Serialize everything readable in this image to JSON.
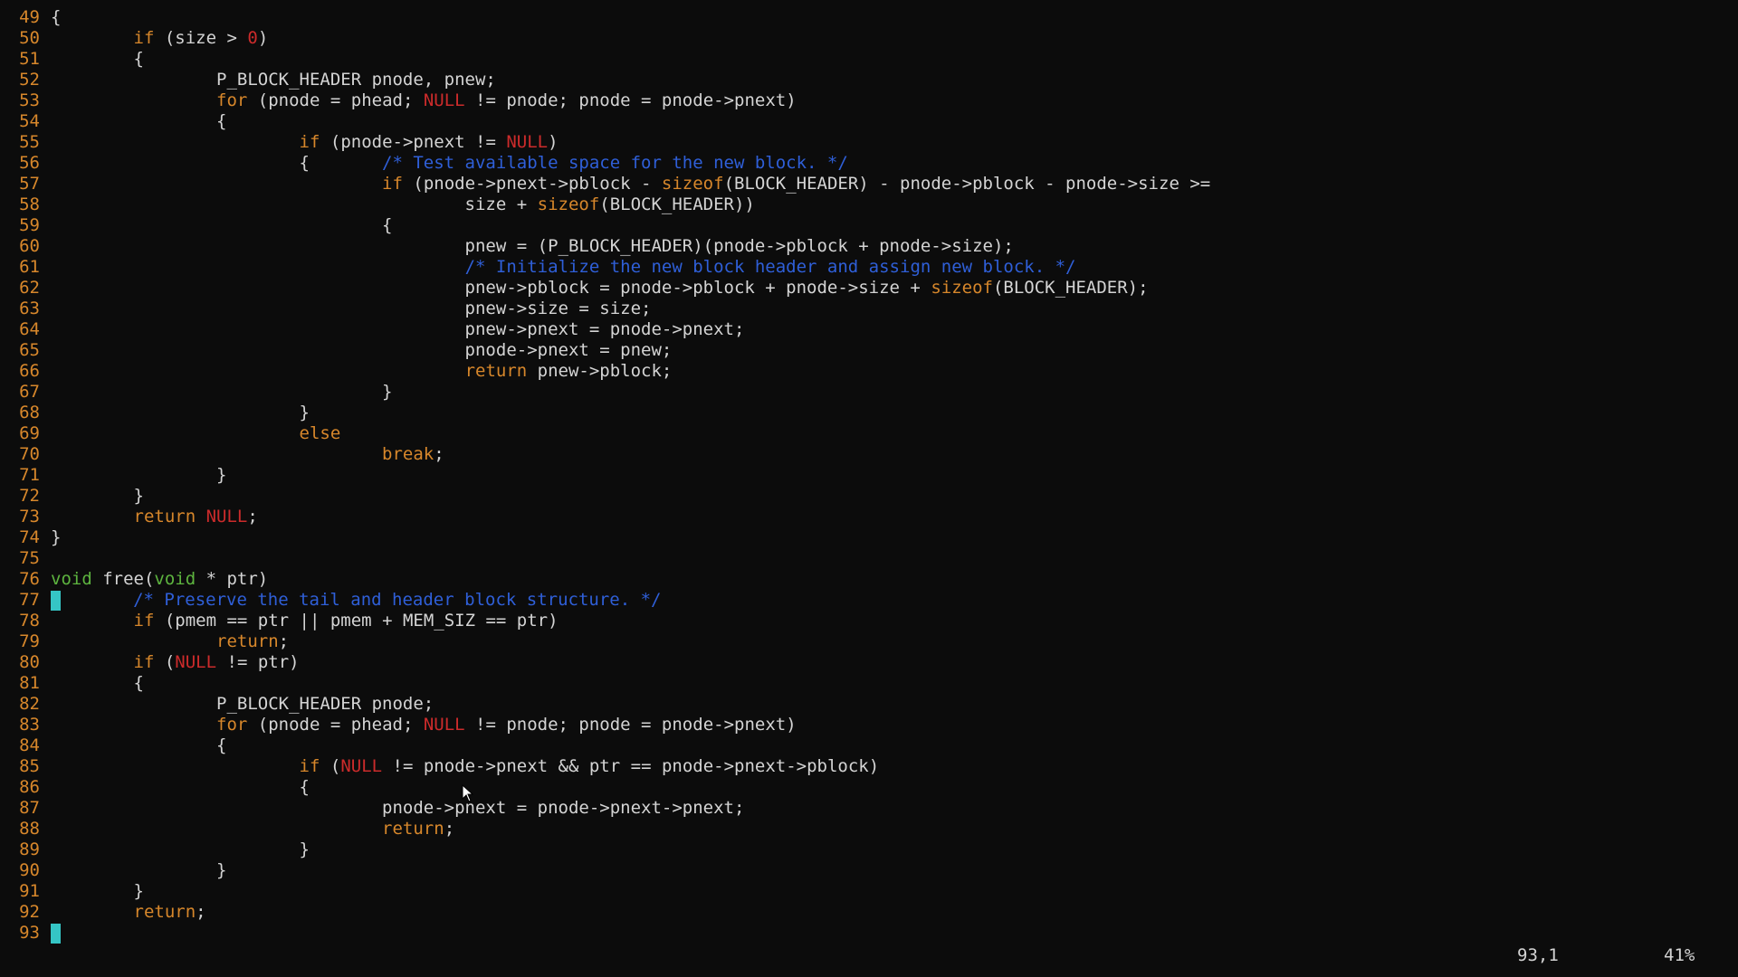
{
  "editor": {
    "lines": [
      {
        "num": "49",
        "segs": [
          {
            "c": "plain",
            "t": "{"
          }
        ]
      },
      {
        "num": "50",
        "segs": [
          {
            "c": "plain",
            "t": "        "
          },
          {
            "c": "kw",
            "t": "if"
          },
          {
            "c": "plain",
            "t": " (size > "
          },
          {
            "c": "num",
            "t": "0"
          },
          {
            "c": "plain",
            "t": ")"
          }
        ]
      },
      {
        "num": "51",
        "segs": [
          {
            "c": "plain",
            "t": "        {"
          }
        ]
      },
      {
        "num": "52",
        "segs": [
          {
            "c": "plain",
            "t": "                P_BLOCK_HEADER pnode, pnew;"
          }
        ]
      },
      {
        "num": "53",
        "segs": [
          {
            "c": "plain",
            "t": "                "
          },
          {
            "c": "kw",
            "t": "for"
          },
          {
            "c": "plain",
            "t": " (pnode = phead; "
          },
          {
            "c": "null",
            "t": "NULL"
          },
          {
            "c": "plain",
            "t": " != pnode; pnode = pnode->pnext)"
          }
        ]
      },
      {
        "num": "54",
        "segs": [
          {
            "c": "plain",
            "t": "                {"
          }
        ]
      },
      {
        "num": "55",
        "segs": [
          {
            "c": "plain",
            "t": "                        "
          },
          {
            "c": "kw",
            "t": "if"
          },
          {
            "c": "plain",
            "t": " (pnode->pnext != "
          },
          {
            "c": "null",
            "t": "NULL"
          },
          {
            "c": "plain",
            "t": ")"
          }
        ]
      },
      {
        "num": "56",
        "segs": [
          {
            "c": "plain",
            "t": "                        {       "
          },
          {
            "c": "cmt",
            "t": "/* Test available space for the new block. */"
          }
        ]
      },
      {
        "num": "57",
        "segs": [
          {
            "c": "plain",
            "t": "                                "
          },
          {
            "c": "kw",
            "t": "if"
          },
          {
            "c": "plain",
            "t": " (pnode->pnext->pblock - "
          },
          {
            "c": "kw",
            "t": "sizeof"
          },
          {
            "c": "plain",
            "t": "(BLOCK_HEADER) - pnode->pblock - pnode->size >="
          }
        ]
      },
      {
        "num": "58",
        "segs": [
          {
            "c": "plain",
            "t": "                                        size + "
          },
          {
            "c": "kw",
            "t": "sizeof"
          },
          {
            "c": "plain",
            "t": "(BLOCK_HEADER))"
          }
        ]
      },
      {
        "num": "59",
        "segs": [
          {
            "c": "plain",
            "t": "                                {"
          }
        ]
      },
      {
        "num": "60",
        "segs": [
          {
            "c": "plain",
            "t": "                                        pnew = (P_BLOCK_HEADER)(pnode->pblock + pnode->size);"
          }
        ]
      },
      {
        "num": "61",
        "segs": [
          {
            "c": "plain",
            "t": "                                        "
          },
          {
            "c": "cmt",
            "t": "/* Initialize the new block header and assign new block. */"
          }
        ]
      },
      {
        "num": "62",
        "segs": [
          {
            "c": "plain",
            "t": "                                        pnew->pblock = pnode->pblock + pnode->size + "
          },
          {
            "c": "kw",
            "t": "sizeof"
          },
          {
            "c": "plain",
            "t": "(BLOCK_HEADER);"
          }
        ]
      },
      {
        "num": "63",
        "segs": [
          {
            "c": "plain",
            "t": "                                        pnew->size = size;"
          }
        ]
      },
      {
        "num": "64",
        "segs": [
          {
            "c": "plain",
            "t": "                                        pnew->pnext = pnode->pnext;"
          }
        ]
      },
      {
        "num": "65",
        "segs": [
          {
            "c": "plain",
            "t": "                                        pnode->pnext = pnew;"
          }
        ]
      },
      {
        "num": "66",
        "segs": [
          {
            "c": "plain",
            "t": "                                        "
          },
          {
            "c": "kw",
            "t": "return"
          },
          {
            "c": "plain",
            "t": " pnew->pblock;"
          }
        ]
      },
      {
        "num": "67",
        "segs": [
          {
            "c": "plain",
            "t": "                                }"
          }
        ]
      },
      {
        "num": "68",
        "segs": [
          {
            "c": "plain",
            "t": "                        }"
          }
        ]
      },
      {
        "num": "69",
        "segs": [
          {
            "c": "plain",
            "t": "                        "
          },
          {
            "c": "kw",
            "t": "else"
          }
        ]
      },
      {
        "num": "70",
        "segs": [
          {
            "c": "plain",
            "t": "                                "
          },
          {
            "c": "kw",
            "t": "break"
          },
          {
            "c": "plain",
            "t": ";"
          }
        ]
      },
      {
        "num": "71",
        "segs": [
          {
            "c": "plain",
            "t": "                }"
          }
        ]
      },
      {
        "num": "72",
        "segs": [
          {
            "c": "plain",
            "t": "        }"
          }
        ]
      },
      {
        "num": "73",
        "segs": [
          {
            "c": "plain",
            "t": "        "
          },
          {
            "c": "kw",
            "t": "return"
          },
          {
            "c": "plain",
            "t": " "
          },
          {
            "c": "null",
            "t": "NULL"
          },
          {
            "c": "plain",
            "t": ";"
          }
        ]
      },
      {
        "num": "74",
        "segs": [
          {
            "c": "plain",
            "t": "}"
          }
        ]
      },
      {
        "num": "75",
        "segs": []
      },
      {
        "num": "76",
        "segs": [
          {
            "c": "type",
            "t": "void"
          },
          {
            "c": "plain",
            "t": " free("
          },
          {
            "c": "type",
            "t": "void"
          },
          {
            "c": "plain",
            "t": " * ptr)"
          }
        ]
      },
      {
        "num": "77",
        "cursor": true,
        "segs": [
          {
            "c": "plain",
            "t": "       "
          },
          {
            "c": "cmt",
            "t": "/* Preserve the tail and header block structure. */"
          }
        ]
      },
      {
        "num": "78",
        "segs": [
          {
            "c": "plain",
            "t": "        "
          },
          {
            "c": "kw",
            "t": "if"
          },
          {
            "c": "plain",
            "t": " (pmem == ptr || pmem + MEM_SIZ == ptr)"
          }
        ]
      },
      {
        "num": "79",
        "segs": [
          {
            "c": "plain",
            "t": "                "
          },
          {
            "c": "kw",
            "t": "return"
          },
          {
            "c": "plain",
            "t": ";"
          }
        ]
      },
      {
        "num": "80",
        "segs": [
          {
            "c": "plain",
            "t": "        "
          },
          {
            "c": "kw",
            "t": "if"
          },
          {
            "c": "plain",
            "t": " ("
          },
          {
            "c": "null",
            "t": "NULL"
          },
          {
            "c": "plain",
            "t": " != ptr)"
          }
        ]
      },
      {
        "num": "81",
        "segs": [
          {
            "c": "plain",
            "t": "        {"
          }
        ]
      },
      {
        "num": "82",
        "segs": [
          {
            "c": "plain",
            "t": "                P_BLOCK_HEADER pnode;"
          }
        ]
      },
      {
        "num": "83",
        "segs": [
          {
            "c": "plain",
            "t": "                "
          },
          {
            "c": "kw",
            "t": "for"
          },
          {
            "c": "plain",
            "t": " (pnode = phead; "
          },
          {
            "c": "null",
            "t": "NULL"
          },
          {
            "c": "plain",
            "t": " != pnode; pnode = pnode->pnext)"
          }
        ]
      },
      {
        "num": "84",
        "segs": [
          {
            "c": "plain",
            "t": "                {"
          }
        ]
      },
      {
        "num": "85",
        "segs": [
          {
            "c": "plain",
            "t": "                        "
          },
          {
            "c": "kw",
            "t": "if"
          },
          {
            "c": "plain",
            "t": " ("
          },
          {
            "c": "null",
            "t": "NULL"
          },
          {
            "c": "plain",
            "t": " != pnode->pnext && ptr == pnode->pnext->pblock)"
          }
        ]
      },
      {
        "num": "86",
        "segs": [
          {
            "c": "plain",
            "t": "                        {"
          }
        ]
      },
      {
        "num": "87",
        "segs": [
          {
            "c": "plain",
            "t": "                                pnode->pnext = pnode->pnext->pnext;"
          }
        ]
      },
      {
        "num": "88",
        "segs": [
          {
            "c": "plain",
            "t": "                                "
          },
          {
            "c": "kw",
            "t": "return"
          },
          {
            "c": "plain",
            "t": ";"
          }
        ]
      },
      {
        "num": "89",
        "segs": [
          {
            "c": "plain",
            "t": "                        }"
          }
        ]
      },
      {
        "num": "90",
        "segs": [
          {
            "c": "plain",
            "t": "                }"
          }
        ]
      },
      {
        "num": "91",
        "segs": [
          {
            "c": "plain",
            "t": "        }"
          }
        ]
      },
      {
        "num": "92",
        "segs": [
          {
            "c": "plain",
            "t": "        "
          },
          {
            "c": "kw",
            "t": "return"
          },
          {
            "c": "plain",
            "t": ";"
          }
        ]
      },
      {
        "num": "93",
        "cursor": true,
        "segs": []
      }
    ]
  },
  "status": {
    "position": "93,1",
    "percent": "41%"
  },
  "colors": {
    "background": "#0c0c0c",
    "line_number": "#d7872b",
    "keyword": "#d7872b",
    "null_literal": "#cc2b2b",
    "type": "#5db43f",
    "comment": "#2f5fd8",
    "cursor": "#35c5c5"
  },
  "icons": {
    "mouse": "mouse-pointer-icon"
  }
}
